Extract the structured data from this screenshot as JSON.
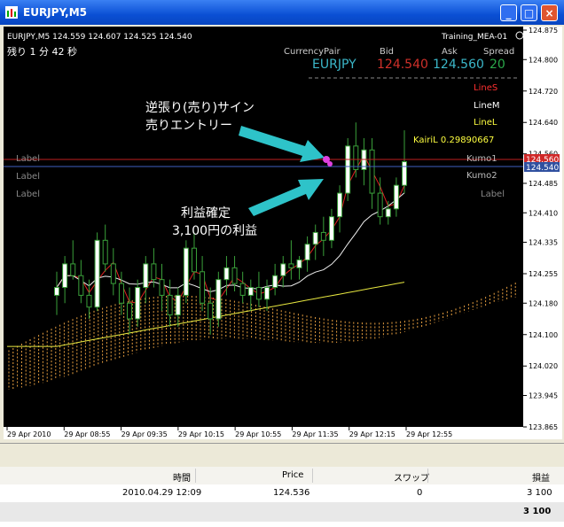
{
  "window": {
    "title": "EURJPY,M5",
    "buttons": [
      "minimize-button",
      "maximize-button",
      "close-button"
    ]
  },
  "chart_header": {
    "symbol_line": "EURJPY,M5  124.559 124.607 124.525 124.540",
    "timer": "残り 1 分 42 秒",
    "indicator_name": "Training_MEA-01",
    "table_headers": [
      "CurrencyPair",
      "Bid",
      "Ask",
      "Spread"
    ],
    "pair": "EURJPY",
    "bid": "124.540",
    "ask": "124.560",
    "spread": "20",
    "line_s": "LineS",
    "line_m": "LineM",
    "line_l": "LineL",
    "kairi": "KairiL  0.29890667",
    "kumo1": "Kumo1",
    "kumo2": "Kumo2",
    "label_right": "Label",
    "labels_left": [
      "Label",
      "Label",
      "Label"
    ]
  },
  "annotations": {
    "entry_line1": "逆張り(売り)サイン",
    "entry_line2": "売りエントリー",
    "profit_line1": "利益確定",
    "profit_line2": "3,100円の利益"
  },
  "price_axis": {
    "ticks": [
      "124.875",
      "124.800",
      "124.720",
      "124.640",
      "124.560",
      "124.485",
      "124.410",
      "124.335",
      "124.255",
      "124.180",
      "124.100",
      "124.020",
      "123.945",
      "123.865"
    ],
    "current_bid_tag": "124.560",
    "current_tag": "124.540"
  },
  "time_axis": {
    "ticks": [
      "29 Apr 2010",
      "29 Apr 08:55",
      "29 Apr 09:35",
      "29 Apr 10:15",
      "29 Apr 10:55",
      "29 Apr 11:35",
      "29 Apr 12:15",
      "29 Apr 12:55"
    ]
  },
  "chart_data": {
    "type": "candlestick",
    "symbol": "EURJPY",
    "timeframe": "M5",
    "ylim": [
      123.865,
      124.875
    ],
    "candles": [
      [
        124.2,
        124.26,
        124.15,
        124.22
      ],
      [
        124.22,
        124.3,
        124.18,
        124.28
      ],
      [
        124.28,
        124.34,
        124.24,
        124.25
      ],
      [
        124.25,
        124.29,
        124.18,
        124.2
      ],
      [
        124.2,
        124.24,
        124.14,
        124.17
      ],
      [
        124.17,
        124.36,
        124.16,
        124.34
      ],
      [
        124.34,
        124.38,
        124.26,
        124.28
      ],
      [
        124.28,
        124.32,
        124.2,
        124.23
      ],
      [
        124.23,
        124.26,
        124.15,
        124.18
      ],
      [
        124.18,
        124.22,
        124.1,
        124.14
      ],
      [
        124.14,
        124.24,
        124.12,
        124.22
      ],
      [
        124.22,
        124.3,
        124.18,
        124.28
      ],
      [
        124.28,
        124.32,
        124.22,
        124.24
      ],
      [
        124.24,
        124.28,
        124.16,
        124.2
      ],
      [
        124.2,
        124.24,
        124.12,
        124.15
      ],
      [
        124.15,
        124.22,
        124.12,
        124.2
      ],
      [
        124.2,
        124.34,
        124.18,
        124.32
      ],
      [
        124.32,
        124.36,
        124.24,
        124.26
      ],
      [
        124.26,
        124.3,
        124.16,
        124.18
      ],
      [
        124.18,
        124.22,
        124.1,
        124.14
      ],
      [
        124.14,
        124.26,
        124.12,
        124.24
      ],
      [
        124.24,
        124.3,
        124.2,
        124.27
      ],
      [
        124.27,
        124.3,
        124.21,
        124.23
      ],
      [
        124.23,
        124.26,
        124.18,
        124.2
      ],
      [
        124.2,
        124.24,
        124.16,
        124.22
      ],
      [
        124.22,
        124.26,
        124.17,
        124.19
      ],
      [
        124.19,
        124.24,
        124.16,
        124.22
      ],
      [
        124.22,
        124.28,
        124.2,
        124.25
      ],
      [
        124.25,
        124.3,
        124.22,
        124.28
      ],
      [
        124.28,
        124.34,
        124.24,
        124.27
      ],
      [
        124.27,
        124.3,
        124.24,
        124.29
      ],
      [
        124.29,
        124.35,
        124.26,
        124.33
      ],
      [
        124.33,
        124.38,
        124.29,
        124.36
      ],
      [
        124.36,
        124.4,
        124.3,
        124.34
      ],
      [
        124.34,
        124.42,
        124.32,
        124.4
      ],
      [
        124.4,
        124.48,
        124.36,
        124.46
      ],
      [
        124.46,
        124.6,
        124.44,
        124.58
      ],
      [
        124.58,
        124.64,
        124.5,
        124.52
      ],
      [
        124.52,
        124.6,
        124.48,
        124.57
      ],
      [
        124.57,
        124.6,
        124.42,
        124.46
      ],
      [
        124.46,
        124.5,
        124.38,
        124.4
      ],
      [
        124.4,
        124.44,
        124.38,
        124.42
      ],
      [
        124.42,
        124.5,
        124.4,
        124.48
      ],
      [
        124.48,
        124.62,
        124.46,
        124.54
      ]
    ]
  },
  "terminal": {
    "headers": [
      "時間",
      "Price",
      "スワップ",
      "損益"
    ],
    "row": [
      "2010.04.29 12:09",
      "124.536",
      "0",
      "3 100"
    ],
    "total": "3 100"
  }
}
